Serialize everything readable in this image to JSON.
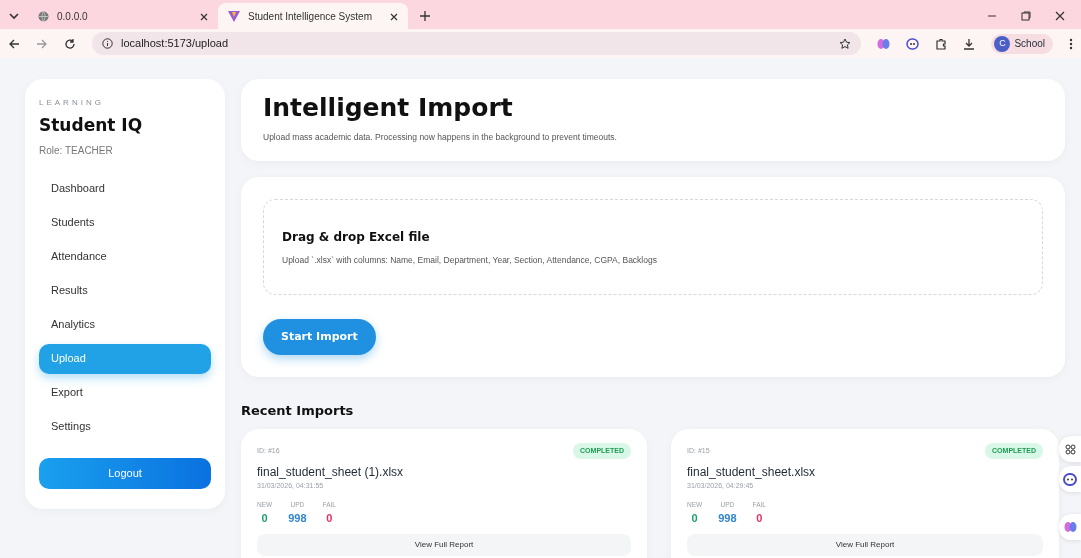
{
  "browser": {
    "tabs": [
      {
        "title": "0.0.0.0",
        "kind": "globe",
        "selected": false
      },
      {
        "title": "Student Intelligence System",
        "kind": "logo",
        "selected": true
      }
    ],
    "url": "localhost:5173/upload",
    "profile_initial": "C",
    "profile": "School"
  },
  "sidebar": {
    "eyebrow": "LEARNING",
    "title": "Student IQ",
    "role": "Role: TEACHER",
    "items": [
      {
        "label": "Dashboard",
        "selected": false
      },
      {
        "label": "Students",
        "selected": false
      },
      {
        "label": "Attendance",
        "selected": false
      },
      {
        "label": "Results",
        "selected": false
      },
      {
        "label": "Analytics",
        "selected": false
      },
      {
        "label": "Upload",
        "selected": true
      },
      {
        "label": "Export",
        "selected": false
      },
      {
        "label": "Settings",
        "selected": false
      }
    ],
    "logout": "Logout"
  },
  "header": {
    "title": "Intelligent Import",
    "subtitle": "Upload mass academic data. Processing now happens in the background to prevent timeouts."
  },
  "upload": {
    "title": "Drag & drop Excel file",
    "description": "Upload `.xlsx` with columns: Name, Email, Department, Year, Section, Attendance, CGPA, Backlogs",
    "button": "Start Import"
  },
  "recent": {
    "heading": "Recent Imports",
    "imports": [
      {
        "id": "ID: #16",
        "status": "COMPLETED",
        "filename": "final_student_sheet (1).xlsx",
        "timestamp": "31/03/2026, 04:31:55",
        "stats": [
          {
            "label": "NEW",
            "value": "0",
            "kind": "new"
          },
          {
            "label": "UPD",
            "value": "998",
            "kind": "updated"
          },
          {
            "label": "FAIL",
            "value": "0",
            "kind": "failed"
          }
        ],
        "action": "View Full Report"
      },
      {
        "id": "ID: #15",
        "status": "COMPLETED",
        "filename": "final_student_sheet.xlsx",
        "timestamp": "31/03/2026, 04:29:45",
        "stats": [
          {
            "label": "NEW",
            "value": "0",
            "kind": "new"
          },
          {
            "label": "UPD",
            "value": "998",
            "kind": "updated"
          },
          {
            "label": "FAIL",
            "value": "0",
            "kind": "failed"
          }
        ],
        "action": "View Full Report"
      }
    ]
  }
}
